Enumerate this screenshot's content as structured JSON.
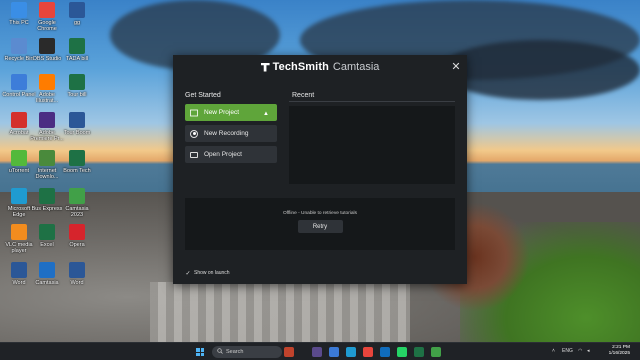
{
  "window": {
    "brand": "TechSmith",
    "product": "Camtasia",
    "close_glyph": "✕"
  },
  "get_started": {
    "title": "Get Started",
    "new_project": "New Project",
    "new_recording": "New Recording",
    "open_project": "Open Project"
  },
  "recent": {
    "title": "Recent"
  },
  "tutorials": {
    "message": "Offline - Unable to retrieve tutorials",
    "retry_label": "Retry"
  },
  "show_on_launch": {
    "label": "Show on launch",
    "checked": true
  },
  "desktop_icons": [
    {
      "label": "This PC",
      "icon": "computer-icon",
      "color": "#3a8ee6"
    },
    {
      "label": "Google Chrome",
      "icon": "chrome-icon",
      "color": "#e8453c"
    },
    {
      "label": "gg",
      "icon": "word-icon",
      "color": "#2b5797"
    },
    {
      "label": "Recycle Bin",
      "icon": "recycle-bin-icon",
      "color": "#5b8bd0"
    },
    {
      "label": "OBS Studio",
      "icon": "obs-icon",
      "color": "#2a2a2a"
    },
    {
      "label": "TADA bill",
      "icon": "excel-icon",
      "color": "#1e7145"
    },
    {
      "label": "Control Panel",
      "icon": "control-panel-icon",
      "color": "#3d7dd9"
    },
    {
      "label": "Adobe Illustrat...",
      "icon": "illustrator-icon",
      "color": "#ff7c00"
    },
    {
      "label": "Tour bill",
      "icon": "excel-icon",
      "color": "#1e7145"
    },
    {
      "label": "Acrobat",
      "icon": "acrobat-icon",
      "color": "#d4302c"
    },
    {
      "label": "Adobe Premiere Pr...",
      "icon": "premiere-icon",
      "color": "#4b2d83"
    },
    {
      "label": "Tour Boom",
      "icon": "word-icon",
      "color": "#2b5797"
    },
    {
      "label": "uTorrent",
      "icon": "utorrent-icon",
      "color": "#53b93b"
    },
    {
      "label": "Internet Downlo...",
      "icon": "idm-icon",
      "color": "#4a8a3c"
    },
    {
      "label": "Boom Tech",
      "icon": "excel-icon",
      "color": "#1e7145"
    },
    {
      "label": "Microsoft Edge",
      "icon": "edge-icon",
      "color": "#1f9bd1"
    },
    {
      "label": "Bus Express",
      "icon": "excel-icon",
      "color": "#1e7145"
    },
    {
      "label": "Camtasia 2023",
      "icon": "camtasia-icon",
      "color": "#41a048"
    },
    {
      "label": "VLC media player",
      "icon": "vlc-icon",
      "color": "#f28c1e"
    },
    {
      "label": "Excel",
      "icon": "excel-icon",
      "color": "#1e7145"
    },
    {
      "label": "Opera",
      "icon": "opera-icon",
      "color": "#d6242c"
    },
    {
      "label": "Word",
      "icon": "word-icon",
      "color": "#2b5797"
    },
    {
      "label": "Camtasia",
      "icon": "camtasia-icon",
      "color": "#1f6fc5"
    },
    {
      "label": "Word",
      "icon": "word-icon",
      "color": "#2b5797"
    }
  ],
  "taskbar": {
    "search_label": "Search",
    "search_icon": "search-icon",
    "time": "2:21 PM",
    "date": "1/16/2025",
    "language": "ENG"
  }
}
